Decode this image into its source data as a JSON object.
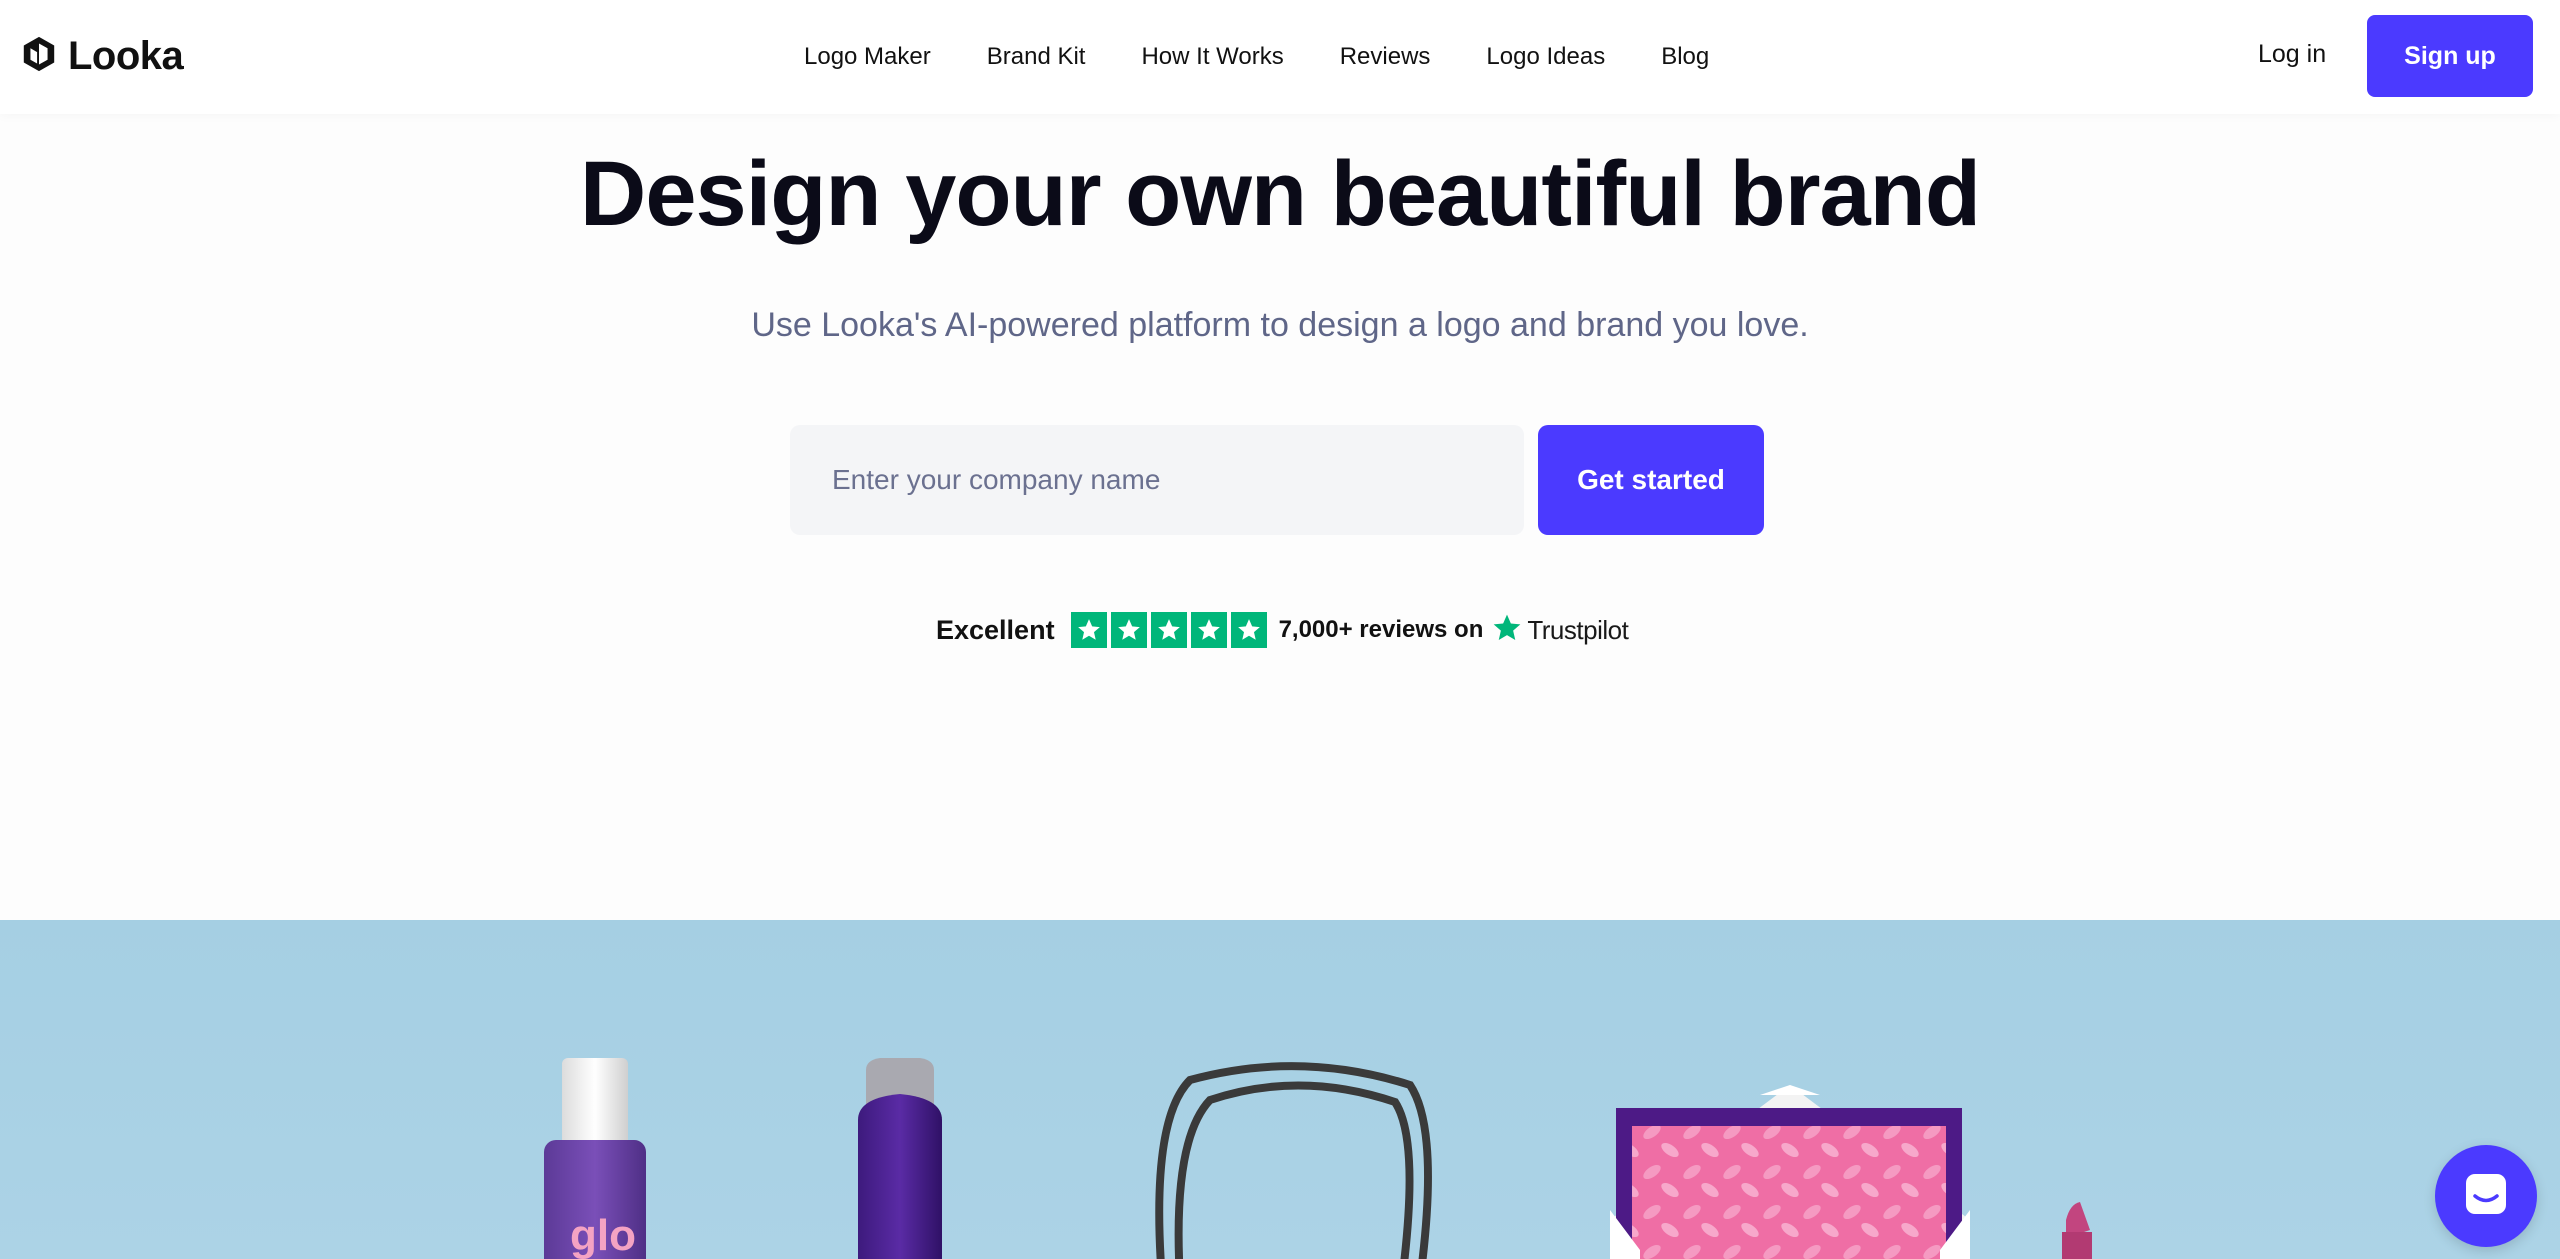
{
  "header": {
    "brand_name": "Looka",
    "nav": [
      "Logo Maker",
      "Brand Kit",
      "How It Works",
      "Reviews",
      "Logo Ideas",
      "Blog"
    ],
    "login_label": "Log in",
    "signup_label": "Sign up"
  },
  "hero": {
    "title": "Design your own beautiful brand",
    "subtitle": "Use Looka's AI-powered platform to design a logo and brand you love.",
    "input_placeholder": "Enter your company name",
    "cta_label": "Get started"
  },
  "trust": {
    "rating_word": "Excellent",
    "stars": 5,
    "reviews_text": "7,000+ reviews on",
    "provider": "Trustpilot"
  },
  "photo": {
    "bottle_label": "glo"
  },
  "colors": {
    "accent": "#4b3aff",
    "trustpilot_green": "#00b67a",
    "photo_background": "#a5cfe3"
  },
  "icons": {
    "brand": "looka-logo-icon",
    "star": "star-icon",
    "chat": "chat-icon"
  }
}
